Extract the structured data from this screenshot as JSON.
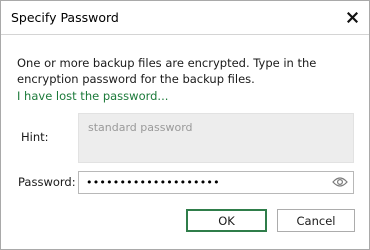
{
  "window": {
    "title": "Specify Password"
  },
  "icons": {
    "close": "close-icon",
    "reveal": "eye-icon"
  },
  "message": "One or more backup files are encrypted. Type in the encryption password for the backup files.",
  "lost_password_link": "I have lost the password...",
  "hint": {
    "label": "Hint:",
    "value": "standard password"
  },
  "password": {
    "label": "Password:",
    "value": "••••••••••••••••••••"
  },
  "buttons": {
    "ok": "OK",
    "cancel": "Cancel"
  },
  "colors": {
    "link": "#1c7a3a",
    "ok_border": "#2f7d4a",
    "hint_background": "#ededed"
  }
}
